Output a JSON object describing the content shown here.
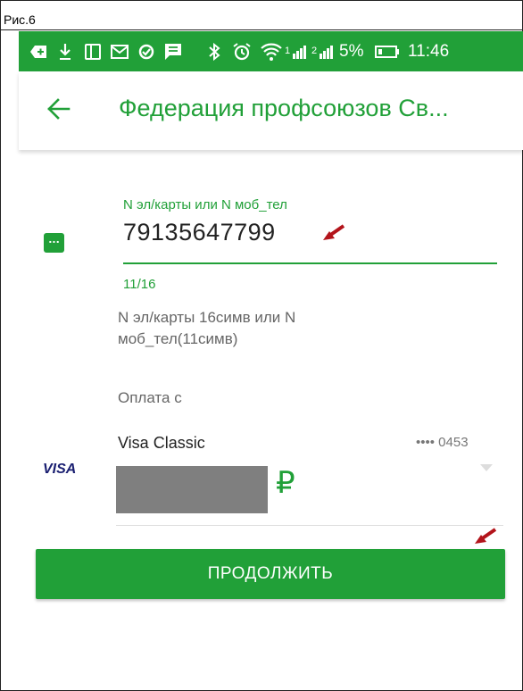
{
  "caption": "Рис.6",
  "status_bar": {
    "battery": "5%",
    "time": "11:46",
    "signal_1": "1",
    "signal_2": "2",
    "icons": [
      "plus-badge-icon",
      "download-icon",
      "tablet-icon",
      "mail-icon",
      "sync-icon",
      "message-icon",
      "bluetooth-icon",
      "alarm-icon",
      "wifi-icon",
      "signal-icon",
      "battery-icon"
    ]
  },
  "header": {
    "title": "Федерация профсоюзов Св...",
    "back_icon": "arrow-left-icon"
  },
  "field": {
    "label": "N эл/карты или N моб_тел",
    "value": "79135647799",
    "counter": "11/16",
    "hint": "N эл/карты 16симв или N моб_тел(11симв)"
  },
  "payment": {
    "label": "Оплата с",
    "card_logo": "VISA",
    "card_name": "Visa Classic",
    "card_number": "•••• 0453",
    "currency": "₽"
  },
  "action": {
    "continue_label": "ПРОДОЛЖИТЬ"
  },
  "colors": {
    "brand": "#21a038",
    "annotation_arrow": "#b3141b"
  }
}
